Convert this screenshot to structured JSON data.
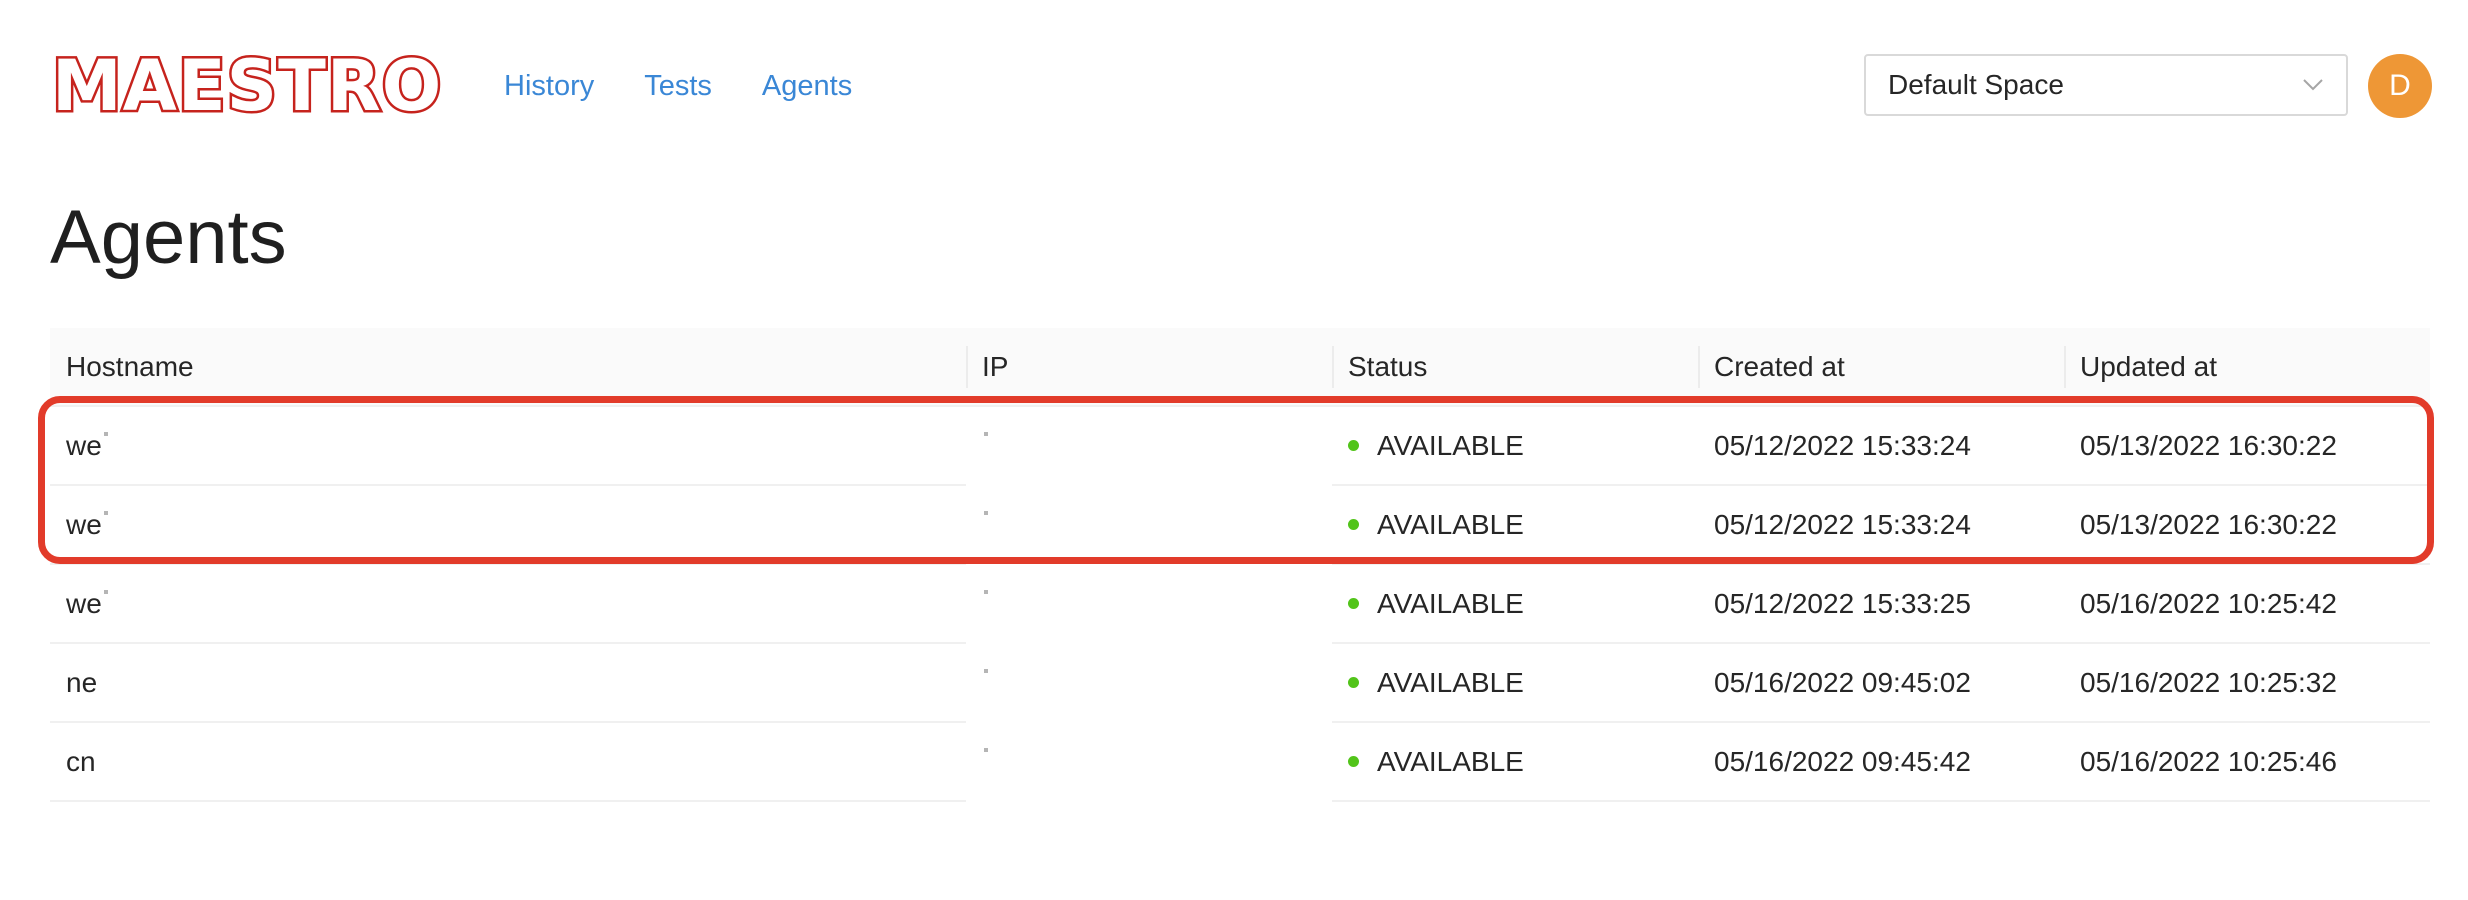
{
  "header": {
    "logo": "MAESTRO",
    "nav": [
      "History",
      "Tests",
      "Agents"
    ],
    "space_select": "Default Space",
    "avatar_initial": "D"
  },
  "page": {
    "title": "Agents"
  },
  "table": {
    "columns": [
      "Hostname",
      "IP",
      "Status",
      "Created at",
      "Updated at"
    ],
    "rows": [
      {
        "hostname": "we",
        "ip": "",
        "status": "AVAILABLE",
        "created": "05/12/2022 15:33:24",
        "updated": "05/13/2022 16:30:22"
      },
      {
        "hostname": "we",
        "ip": "",
        "status": "AVAILABLE",
        "created": "05/12/2022 15:33:24",
        "updated": "05/13/2022 16:30:22"
      },
      {
        "hostname": "we",
        "ip": "",
        "status": "AVAILABLE",
        "created": "05/12/2022 15:33:25",
        "updated": "05/16/2022 10:25:42"
      },
      {
        "hostname": "ne",
        "ip": "",
        "status": "AVAILABLE",
        "created": "05/16/2022 09:45:02",
        "updated": "05/16/2022 10:25:32"
      },
      {
        "hostname": "cn",
        "ip": "",
        "status": "AVAILABLE",
        "created": "05/16/2022 09:45:42",
        "updated": "05/16/2022 10:25:46"
      }
    ]
  },
  "colors": {
    "logo": "#c6231d",
    "link": "#3a87d6",
    "avatar": "#ee9736",
    "status_available": "#52c41a",
    "highlight": "#e23b2a"
  },
  "icons": {
    "select_arrow": "chevron-down-icon",
    "status": "status-dot-icon"
  }
}
